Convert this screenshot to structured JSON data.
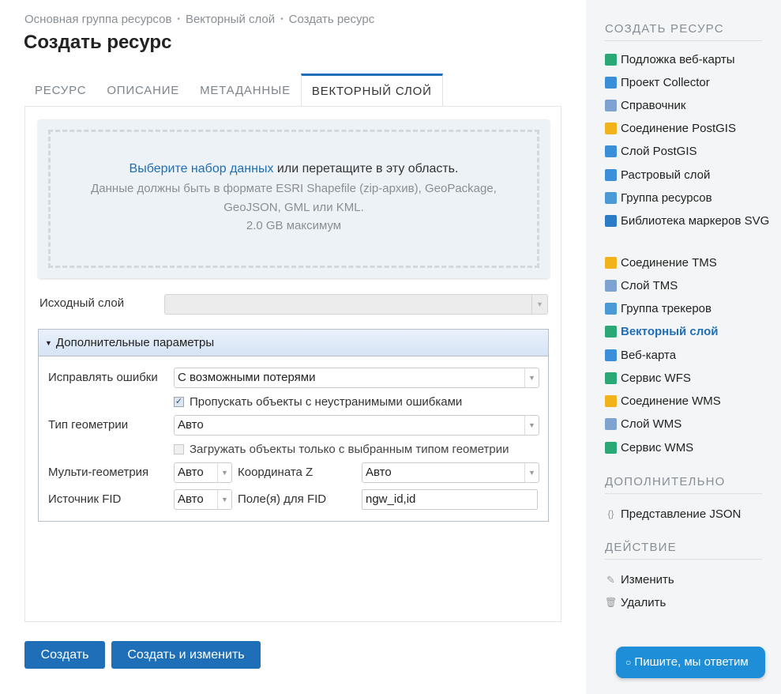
{
  "breadcrumb": [
    "Основная группа ресурсов",
    "Векторный слой",
    "Создать ресурс"
  ],
  "page_title": "Создать ресурс",
  "tabs": [
    "РЕСУРС",
    "ОПИСАНИЕ",
    "МЕТАДАННЫЕ",
    "ВЕКТОРНЫЙ СЛОЙ"
  ],
  "upload": {
    "link": "Выберите набор данных",
    "text": " или перетащите в эту область.",
    "hint": "Данные должны быть в формате ESRI Shapefile (zip-архив), GeoPackage, GeoJSON, GML или KML.",
    "max": "2.0 GB максимум"
  },
  "source_layer": {
    "label": "Исходный слой",
    "value": ""
  },
  "advanced": {
    "title": "Дополнительные параметры",
    "fix_errors": {
      "label": "Исправлять ошибки",
      "value": "С возможными потерями"
    },
    "skip_errors": {
      "label": "Пропускать объекты с неустранимыми ошибками",
      "checked": true
    },
    "geometry_type": {
      "label": "Тип геометрии",
      "value": "Авто"
    },
    "only_geometry": {
      "label": "Загружать объекты только с выбранным типом геометрии",
      "checked": false
    },
    "multi_geometry": {
      "label": "Мульти-геометрия",
      "value": "Авто"
    },
    "coord_z": {
      "label": "Координата Z",
      "value": "Авто"
    },
    "fid_source": {
      "label": "Источник FID",
      "value": "Авто"
    },
    "fid_fields": {
      "label": "Поле(я) для FID",
      "value": "ngw_id,id"
    }
  },
  "buttons": {
    "create": "Создать",
    "create_edit": "Создать и изменить"
  },
  "sidebar": {
    "create_title": "СОЗДАТЬ РЕСУРС",
    "create_items": [
      {
        "label": "Подложка веб-карты",
        "icon": "basemap-icon",
        "color": "#2aa876"
      },
      {
        "label": "Проект Collector",
        "icon": "collector-icon",
        "color": "#3a8fd8"
      },
      {
        "label": "Справочник",
        "icon": "lookup-table-icon",
        "color": "#7fa3d1"
      },
      {
        "label": "Соединение PostGIS",
        "icon": "postgis-connection-icon",
        "color": "#f2b21b"
      },
      {
        "label": "Слой PostGIS",
        "icon": "postgis-layer-icon",
        "color": "#3a8fd8"
      },
      {
        "label": "Растровый слой",
        "icon": "raster-layer-icon",
        "color": "#3a8fd8"
      },
      {
        "label": "Группа ресурсов",
        "icon": "folder-icon",
        "color": "#4a9ad6"
      },
      {
        "label": "Библиотека маркеров SVG",
        "icon": "svg-library-icon",
        "color": "#2b7bc6"
      },
      {
        "label": "Соединение TMS",
        "icon": "tms-connection-icon",
        "color": "#f2b21b"
      },
      {
        "label": "Слой TMS",
        "icon": "tms-layer-icon",
        "color": "#7fa3d1"
      },
      {
        "label": "Группа трекеров",
        "icon": "tracker-group-icon",
        "color": "#4a9ad6"
      },
      {
        "label": "Векторный слой",
        "icon": "vector-layer-icon",
        "color": "#2aa876"
      },
      {
        "label": "Веб-карта",
        "icon": "webmap-icon",
        "color": "#3a8fd8"
      },
      {
        "label": "Сервис WFS",
        "icon": "wfs-service-icon",
        "color": "#2aa876"
      },
      {
        "label": "Соединение WMS",
        "icon": "wms-connection-icon",
        "color": "#f2b21b"
      },
      {
        "label": "Слой WMS",
        "icon": "wms-layer-icon",
        "color": "#7fa3d1"
      },
      {
        "label": "Сервис WMS",
        "icon": "wms-service-icon",
        "color": "#2aa876"
      }
    ],
    "extra_title": "ДОПОЛНИТЕЛЬНО",
    "extra_items": [
      {
        "label": "Представление JSON",
        "icon": "json-icon"
      }
    ],
    "action_title": "ДЕЙСТВИЕ",
    "action_items": [
      {
        "label": "Изменить",
        "icon": "pencil-icon"
      },
      {
        "label": "Удалить",
        "icon": "trash-icon"
      }
    ]
  },
  "chat": {
    "label": "Пишите, мы ответим"
  },
  "colors": {
    "accent": "#1e6fb8",
    "chat": "#1e8ed8"
  }
}
